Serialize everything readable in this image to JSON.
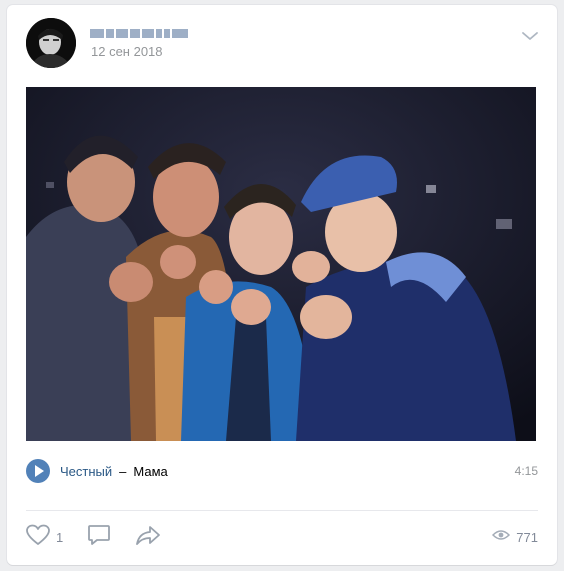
{
  "post": {
    "author_name": "",
    "date": "12 сен 2018",
    "audio": {
      "artist": "Честный",
      "separator": "–",
      "title": "Мама",
      "duration": "4:15"
    },
    "likes": "1",
    "views": "771"
  },
  "icons": {
    "menu": "chevron-down-icon",
    "play": "play-icon",
    "like": "heart-icon",
    "comment": "comment-icon",
    "share": "share-icon",
    "views": "eye-icon"
  },
  "colors": {
    "accent": "#5181b8",
    "link": "#2a5885",
    "muted": "#939699"
  }
}
